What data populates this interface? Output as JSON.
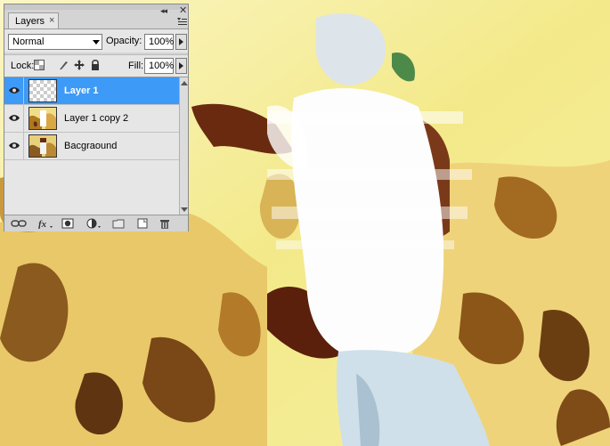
{
  "layers_panel": {
    "tab_label": "Layers",
    "tab_close_glyph": "×",
    "collapse_glyph": "◂◂",
    "close_glyph": "✕",
    "menu_icon": "panel-menu-icon",
    "blend_mode": "Normal",
    "opacity_label": "Opacity:",
    "opacity_value": "100%",
    "lock_label": "Lock:",
    "lock_icons": [
      "lock-transparent-pixels-icon",
      "lock-image-pixels-icon",
      "lock-position-icon",
      "lock-all-icon"
    ],
    "fill_label": "Fill:",
    "fill_value": "100%",
    "layers": [
      {
        "name": "Layer 1",
        "selected": true,
        "visible": true,
        "thumbnail": "transparent"
      },
      {
        "name": "Layer 1 copy 2",
        "selected": false,
        "visible": true,
        "thumbnail": "photo"
      },
      {
        "name": "Bacgraound",
        "selected": false,
        "visible": true,
        "thumbnail": "photo"
      }
    ],
    "bottom_icons": [
      "link-layers-icon",
      "fx-icon",
      "add-mask-icon",
      "adjustment-layer-icon",
      "new-group-icon",
      "new-layer-icon",
      "delete-layer-icon"
    ]
  },
  "colors": {
    "selection": "#3d9af7",
    "panel_bg": "#d4d4d4",
    "canvas_yellow": "#f3e98a"
  }
}
